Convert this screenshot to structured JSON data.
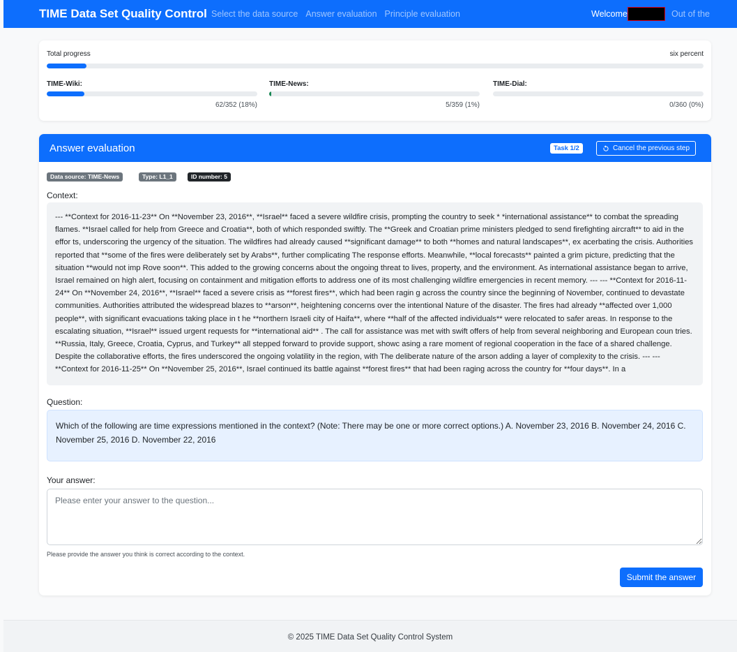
{
  "navbar": {
    "brand": "TIME Data Set Quality Control",
    "links": [
      "Select the data source",
      "Answer evaluation",
      "Principle evaluation"
    ],
    "welcome": "Welcome,",
    "logout": "Out of the"
  },
  "progress": {
    "total_label": "Total progress",
    "total_text": "six percent",
    "total_fraction": 0.06,
    "datasets": [
      {
        "name": "TIME-Wiki:",
        "count": "62/352 (18%)",
        "fraction": 0.18
      },
      {
        "name": "TIME-News:",
        "count": "5/359 (1%)",
        "fraction": 0.01
      },
      {
        "name": "TIME-Dial:",
        "count": "0/360 (0%)",
        "fraction": 0.0
      }
    ]
  },
  "evaluation": {
    "title": "Answer evaluation",
    "task": "Task 1/2",
    "cancel": "Cancel the previous step",
    "badges": [
      "Data source: TIME-News",
      "Type: L1_1",
      "ID number: 5"
    ],
    "context_label": "Context:",
    "context": "--- **Context for 2016-11-23** On **November 23, 2016**, **Israel** faced a severe wildfire crisis, prompting the country to seek * *international assistance** to combat the spreading flames. **Israel called for help from Greece and Croatia**, both of which responded swiftly. The **Greek and Croatian prime ministers pledged to send firefighting aircraft** to aid in the effor ts, underscoring the urgency of the situation. The wildfires had already caused **significant damage** to both **homes and natural landscapes**, ex acerbating the crisis. Authorities reported that **some of the fires were deliberately set by Arabs**, further complicating The response efforts. Meanwhile, **local forecasts** painted a grim picture, predicting that the situation **would not imp Rove soon**. This added to the growing concerns about the ongoing threat to lives, property, and the environment. As international assistance began to arrive, Israel remained on high alert, focusing on containment and mitigation efforts to address one of its most challenging wildfire emergencies in recent memory. --- --- **Context for 2016-11-24** On **November 24, 2016**, **Israel** faced a severe crisis as **forest fires**, which had been ragin g across the country since the beginning of November, continued to devastate communities. Authorities attributed the widespread blazes to **arson**, heightening concerns over the intentional Nature of the disaster. The fires had already **affected over 1,000 people**, with significant evacuations taking place in t he **northern Israeli city of Haifa**, where **half of the affected individuals** were relocated to safer areas. In response to the escalating situation, **Israel** issued urgent requests for **international aid** . The call for assistance was met with swift offers of help from several neighboring and European coun tries. **Russia, Italy, Greece, Croatia, Cyprus, and Turkey** all stepped forward to provide support, showc asing a rare moment of regional cooperation in the face of a shared challenge. Despite the collaborative efforts, the fires underscored the ongoing volatility in the region, with The deliberate nature of the arson adding a layer of complexity to the crisis. --- --- **Context for 2016-11-25** On **November 25, 2016**, Israel continued its battle against **forest fires** that had been raging across the country for **four days**. In a",
    "question_label": "Question:",
    "question": "Which of the following are time expressions mentioned in the context? (Note: There may be one or more correct options.) A. November 23, 2016 B. November 24, 2016 C. November 25, 2016 D. November 22, 2016",
    "answer_label": "Your answer:",
    "answer_placeholder": "Please enter your answer to the question...",
    "hint": "Please provide the answer you think is correct according to the context.",
    "submit": "Submit the answer"
  },
  "footer": "© 2025 TIME Data Set Quality Control System"
}
